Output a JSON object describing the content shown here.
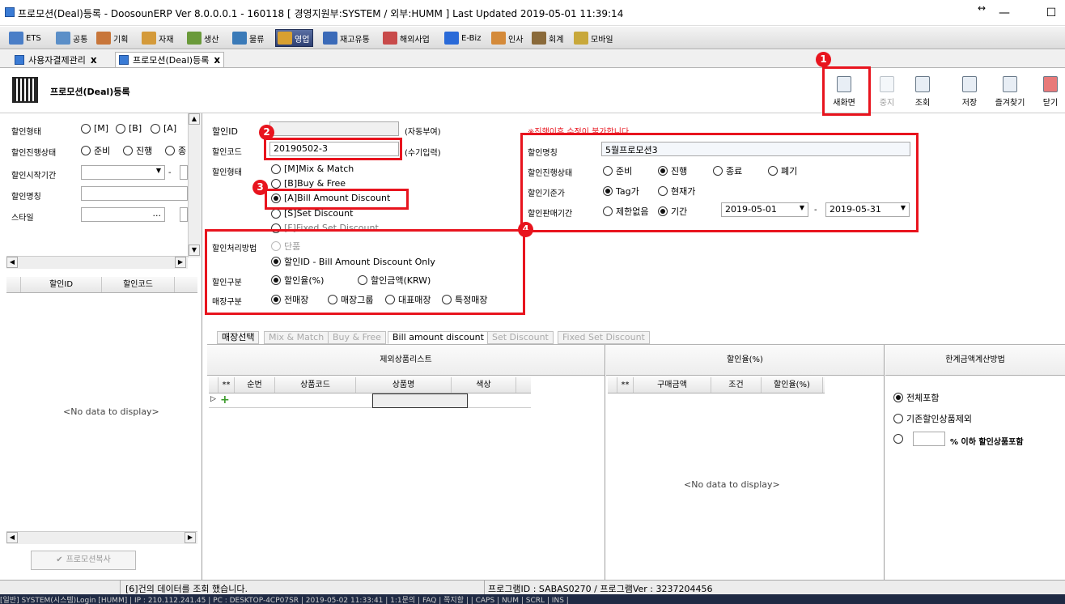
{
  "window": {
    "title": "프로모션(Deal)등록 - DoosounERP Ver 8.0.0.0.1 - 160118 [ 경영지원부:SYSTEM / 외부:HUMM ]    Last Updated 2019-05-01 11:39:14",
    "minimize": "—",
    "maximize": "☐",
    "restore": "↔"
  },
  "modules": [
    "ETS",
    "공통",
    "기획",
    "자재",
    "생산",
    "물류",
    "영업",
    "재고유통",
    "해외사업",
    "E-Biz",
    "인사",
    "회계",
    "모바일"
  ],
  "module_colors": [
    "#4a7ec7",
    "#5b8fc8",
    "#c8763a",
    "#d49a3a",
    "#6a9a3a",
    "#3a7ab8",
    "#d8a030",
    "#3a6ab8",
    "#c84a4a",
    "#2a6ad8",
    "#d48a3a",
    "#8a6a3a",
    "#c8a83a"
  ],
  "doc_tabs": [
    "사용자결제관리",
    "프로모션(Deal)등록"
  ],
  "doc_tab_close": "x",
  "page_title": "프로모션(Deal)등록",
  "toolbar": [
    "새화면",
    "중지",
    "조회",
    "저장",
    "즐겨찾기",
    "닫기"
  ],
  "badges": [
    "1",
    "2",
    "3",
    "4"
  ],
  "left": {
    "type_label": "할인형태",
    "type_opts": [
      "[M]",
      "[B]",
      "[A]"
    ],
    "status_label": "할인진행상태",
    "status_opts": [
      "준비",
      "진행",
      "종"
    ],
    "start_label": "할인시작기간",
    "start_sep": "-",
    "name_label": "할인명칭",
    "style_label": "스타일",
    "ellipsis": "...",
    "cols": [
      "할인ID",
      "할인코드"
    ],
    "no_data": "<No data to display>",
    "copy_btn": "프로모션복사"
  },
  "form": {
    "id_label": "할인ID",
    "id_hint": "(자동부여)",
    "code_label": "할인코드",
    "code_value": "20190502-3",
    "code_hint": "(수기입력)",
    "type_label": "할인형태",
    "type_opts": [
      "[M]Mix & Match",
      "[B]Buy & Free",
      "[A]Bill Amount Discount",
      "[S]Set Discount",
      "[F]Fixed Set Discount"
    ],
    "process_label": "할인처리방법",
    "process_opts": [
      "단품",
      "할인ID - Bill Amount Discount Only"
    ],
    "kind_label": "할인구분",
    "kind_opts": [
      "할인율(%)",
      "할인금액(KRW)"
    ],
    "store_label": "매장구분",
    "store_opts": [
      "전매장",
      "매장그룹",
      "대표매장",
      "특정매장"
    ],
    "warning": "※진행이후 수정이 불가합니다",
    "name_label": "할인명칭",
    "name_value": "5월프로모션3",
    "status_label": "할인진행상태",
    "status_opts": [
      "준비",
      "진행",
      "종료",
      "폐기"
    ],
    "base_label": "할인기준가",
    "base_opts": [
      "Tag가",
      "현재가"
    ],
    "period_label": "할인판매기간",
    "period_opts": [
      "제한없음",
      "기간"
    ],
    "date_from": "2019-05-01",
    "date_sep": "-",
    "date_to": "2019-05-31"
  },
  "subtabs": [
    "매장선택",
    "Mix & Match",
    "Buy & Free",
    "Bill amount discount",
    "Set Discount",
    "Fixed Set Discount"
  ],
  "excluded": {
    "title": "제외상품리스트",
    "cols": [
      "**",
      "순번",
      "상품코드",
      "상품명",
      "색상"
    ]
  },
  "rate": {
    "title": "할인율(%)",
    "cols": [
      "**",
      "구매금액",
      "조건",
      "할인율(%)"
    ],
    "no_data": "<No data to display>"
  },
  "limit": {
    "title": "한계금액계산방법",
    "opts": [
      "전체포함",
      "기존할인상품제외"
    ],
    "suffix": "% 이하 할인상품포함"
  },
  "status": {
    "message": "[6]건의 데이터를 조회 했습니다.",
    "program": "프로그램ID : SABAS0270 / 프로그램Ver : 3237204456"
  },
  "taskbar": "[일반]  SYSTEM(시스템)Login [HUMM]   | IP : 210.112.241.45   | PC : DESKTOP-4CP07SR   | 2019-05-02 11:33:41  | 1:1문의 | FAQ |  쪽지함  |           | CAPS | NUM | SCRL | INS |"
}
